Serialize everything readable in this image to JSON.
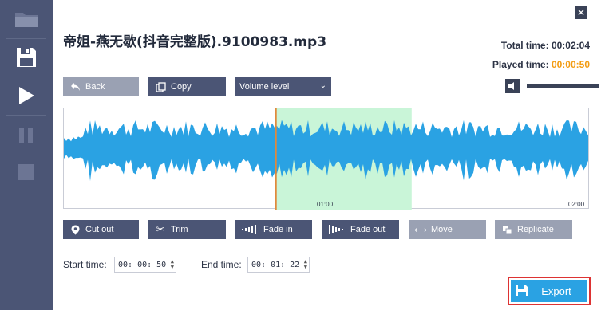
{
  "file_name": "帝姐-燕无歇(抖音完整版).9100983.mp3",
  "total_time": {
    "label": "Total time:",
    "value": "00:02:04"
  },
  "played_time": {
    "label": "Played time:",
    "value": "00:00:50"
  },
  "toolbar": {
    "back_label": "Back",
    "copy_label": "Copy",
    "volume_select_value": "Volume level"
  },
  "volume_percent": 100,
  "waveform": {
    "tick_labels": [
      "01:00",
      "02:00"
    ],
    "total_seconds": 124,
    "selection_start_seconds": 50,
    "selection_end_seconds": 82,
    "wave_color": "#2aa2e3",
    "selection_color": "#c9f5d8",
    "playhead_color": "#e08a3b"
  },
  "actions": {
    "cut_out": "Cut out",
    "trim": "Trim",
    "fade_in": "Fade in",
    "fade_out": "Fade out",
    "move": "Move",
    "replicate": "Replicate"
  },
  "start_time": {
    "label": "Start time:",
    "value": "00: 00: 50"
  },
  "end_time": {
    "label": "End time:",
    "value": "00: 01: 22"
  },
  "export_label": "Export",
  "colors": {
    "sidebar": "#4b5575",
    "button": "#4b5575",
    "button_disabled": "#9aa1b3",
    "accent": "#2aa2e3",
    "played_time": "#f39c12"
  }
}
